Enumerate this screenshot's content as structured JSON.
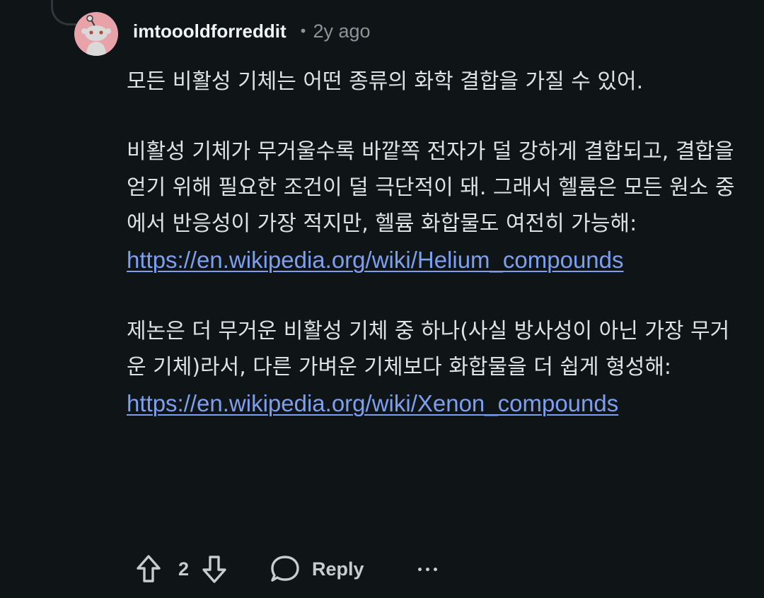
{
  "comment": {
    "author": "imtoooldforreddit",
    "separator": "•",
    "timestamp": "2y ago",
    "avatar_icon": "snoo-avatar-icon",
    "paragraphs": [
      {
        "text": "모든 비활성 기체는 어떤 종류의 화학 결합을 가질 수 있어."
      },
      {
        "text": "비활성 기체가 무거울수록 바깥쪽 전자가 덜 강하게 결합되고, 결합을 얻기 위해 필요한 조건이 덜 극단적이 돼. 그래서 헬륨은 모든 원소 중에서 반응성이 가장 적지만, 헬륨 화합물도 여전히 가능해:",
        "link": "https://en.wikipedia.org/wiki/Helium_compounds"
      },
      {
        "text": "제논은 더 무거운 비활성 기체 중 하나(사실 방사성이 아닌 가장 무거운 기체)라서, 다른 가벼운 기체보다 화합물을 더 쉽게 형성해:",
        "link": "https://en.wikipedia.org/wiki/Xenon_compounds"
      }
    ],
    "actions": {
      "upvote_icon": "arrow-up-icon",
      "vote_count": "2",
      "downvote_icon": "arrow-down-icon",
      "reply_icon": "speech-bubble-icon",
      "reply_label": "Reply",
      "more_icon": "more-horizontal-icon"
    }
  },
  "colors": {
    "background": "#0f1416",
    "text": "#dde2e4",
    "muted": "#8b9598",
    "link": "#7c9ff0",
    "avatar_bg": "#e8a3a8"
  }
}
